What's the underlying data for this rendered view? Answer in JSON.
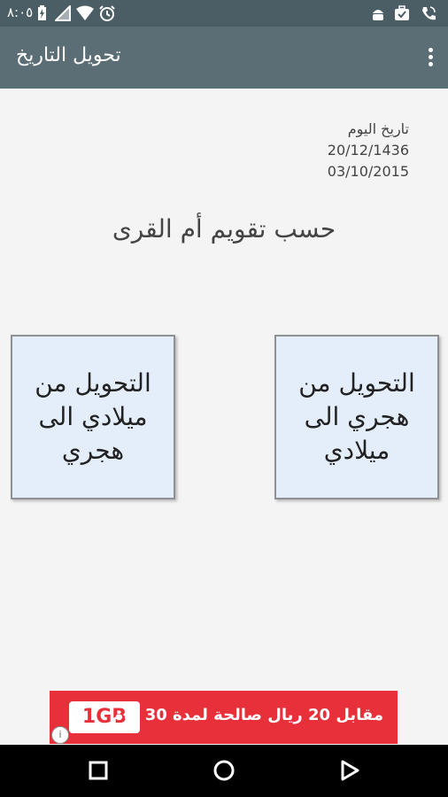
{
  "status_bar": {
    "time": "٨:٠٥",
    "icons": [
      "battery-charging-icon",
      "signal-icon",
      "wifi-icon",
      "alarm-icon",
      "android-icon",
      "briefcase-check-icon",
      "phone-call-icon"
    ]
  },
  "app_bar": {
    "title": "تحويل التاريخ",
    "menu_icon": "more-vertical-icon"
  },
  "today": {
    "label": "تاريخ اليوم",
    "hijri": "20/12/1436",
    "gregorian": "03/10/2015"
  },
  "calendar_note": "حسب تقويم أم القرى",
  "buttons": {
    "greg_to_hijri": "التحويل من ميلادي الى هجري",
    "hijri_to_greg": "التحويل من هجري الى ميلادي"
  },
  "ad": {
    "badge": "1GB",
    "text": "مقابل 20 ريال صالحة لمدة 30 يوم",
    "info_icon": "info-icon"
  },
  "nav_bar": {
    "icons": [
      "recents-square-icon",
      "home-circle-icon",
      "back-triangle-icon"
    ]
  },
  "colors": {
    "status_bar": "#4b5d65",
    "app_bar": "#5b6d75",
    "card_bg": "#e3eefa",
    "ad_bg": "#e8303a"
  }
}
